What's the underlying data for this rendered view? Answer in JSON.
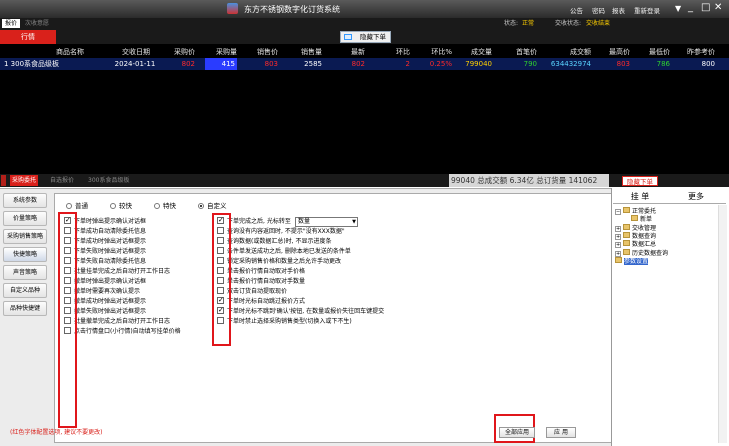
{
  "app": {
    "title": "东方不锈钢数字化订货系统",
    "menu": [
      "公告",
      "密码",
      "报表",
      "重新登录"
    ],
    "window_controls": [
      "▼",
      "_",
      "□",
      "✕"
    ]
  },
  "row2": {
    "tabs": [
      "报价",
      "次收意愿"
    ],
    "status_label": "状态:",
    "status_value": "正常",
    "trade_label": "交收状态:",
    "trade_value": "交收结束"
  },
  "row3": {
    "market_tab": "行情",
    "cancel_button": "隐藏下单"
  },
  "grid": {
    "headers": [
      "商品名称",
      "交收日期",
      "采购价",
      "采购量",
      "销售价",
      "销售量",
      "最新",
      "环比",
      "环比%",
      "成交量",
      "首笔价",
      "成交额",
      "最高价",
      "最低价",
      "昨参考价"
    ],
    "row": {
      "name": "1  300系食品级板",
      "date": "2024-01-11",
      "buy_price": "802",
      "buy_qty": "415",
      "sell_price": "803",
      "sell_qty": "2585",
      "last": "802",
      "change": "2",
      "change_pct": "0.25%",
      "volume": "799040",
      "first": "790",
      "amount": "634432974",
      "high": "803",
      "low": "786",
      "prev": "800"
    }
  },
  "bottombar": {
    "tabs": [
      "采购委托",
      "自选报价",
      "300系食品级板"
    ],
    "summary": "99040 总成交额 6.34亿 总订货量 141062",
    "side_tab": "隐藏下单"
  },
  "leftnav": [
    "系统参数",
    "价量策略",
    "采购销售策略",
    "快捷策略",
    "声音策略",
    "自定义品种",
    "品种快捷键"
  ],
  "radios": [
    {
      "label": "普通",
      "on": false
    },
    {
      "label": "较快",
      "on": false
    },
    {
      "label": "特快",
      "on": false
    },
    {
      "label": "自定义",
      "on": true
    }
  ],
  "col1": [
    {
      "label": "下单时弹出提示确认对话框",
      "on": true
    },
    {
      "label": "下单成功自动清除委托信息",
      "on": false
    },
    {
      "label": "下单成功时弹出对话框提示",
      "on": false
    },
    {
      "label": "下单失败时弹出对话框提示",
      "on": false
    },
    {
      "label": "下单失败自动清除委托信息",
      "on": false
    },
    {
      "label": "批量挂单完成之后自动打开工作日志",
      "on": false
    },
    {
      "label": "撤单时弹出提示确认对话框",
      "on": false
    },
    {
      "label": "撤单时需要再次确认提示",
      "on": false
    },
    {
      "label": "撤单成功时弹出对话框提示",
      "on": false
    },
    {
      "label": "撤单失败时弹出对话框提示",
      "on": false
    },
    {
      "label": "批量撤单完成之后自动打开工作日志",
      "on": false
    },
    {
      "label": "点击行情盘口(小行情)自动填写挂单价格",
      "on": false
    }
  ],
  "col2": [
    {
      "label": "下单完成之后, 光标转至",
      "on": true,
      "dropdown": "数量"
    },
    {
      "label": "查询没有内容返回时, 不提示\"没有XXX数据\"",
      "on": false
    },
    {
      "label": "查询数据(或数据汇总)时, 不显示进度条",
      "on": false
    },
    {
      "label": "条件单发送成功之后, 删除本地已发送的条件单",
      "on": false
    },
    {
      "label": "锁定采购销售价格和数量之后允许手动更改",
      "on": false
    },
    {
      "label": "单击报价行情自动取对手价格",
      "on": false
    },
    {
      "label": "单击报价行情自动取对手数量",
      "on": false
    },
    {
      "label": "双击订货自动提取现价",
      "on": false
    },
    {
      "label": "下单时光标自动跳过报价方式",
      "on": true
    },
    {
      "label": "下单时光标不跳到'确认'按钮, 在数量或报价失往回车键提交",
      "on": true
    },
    {
      "label": "下单时禁止选择采购销售类型(切换入或下不生)",
      "on": false
    }
  ],
  "footnote": "(红色字体配置选项, 建议不要更改)",
  "buttons": {
    "full_apply": "全部应用",
    "apply": "应 用"
  },
  "right": {
    "tabs": [
      "挂 单",
      "更多"
    ],
    "tree": [
      {
        "label": "正常委托",
        "level": 0,
        "pm": "−"
      },
      {
        "label": "新单",
        "level": 1,
        "pm": ""
      },
      {
        "label": "交收管理",
        "level": 0,
        "pm": "+"
      },
      {
        "label": "数据查询",
        "level": 0,
        "pm": "+"
      },
      {
        "label": "数据汇总",
        "level": 0,
        "pm": "+"
      },
      {
        "label": "历史数据查询",
        "level": 0,
        "pm": "+"
      },
      {
        "label": "参数设置",
        "level": 0,
        "pm": "",
        "selected": true
      }
    ]
  },
  "colors": {
    "accent_red": "#d9211b",
    "grid_bg": "#000000",
    "row_sel": "#0a1a52"
  }
}
